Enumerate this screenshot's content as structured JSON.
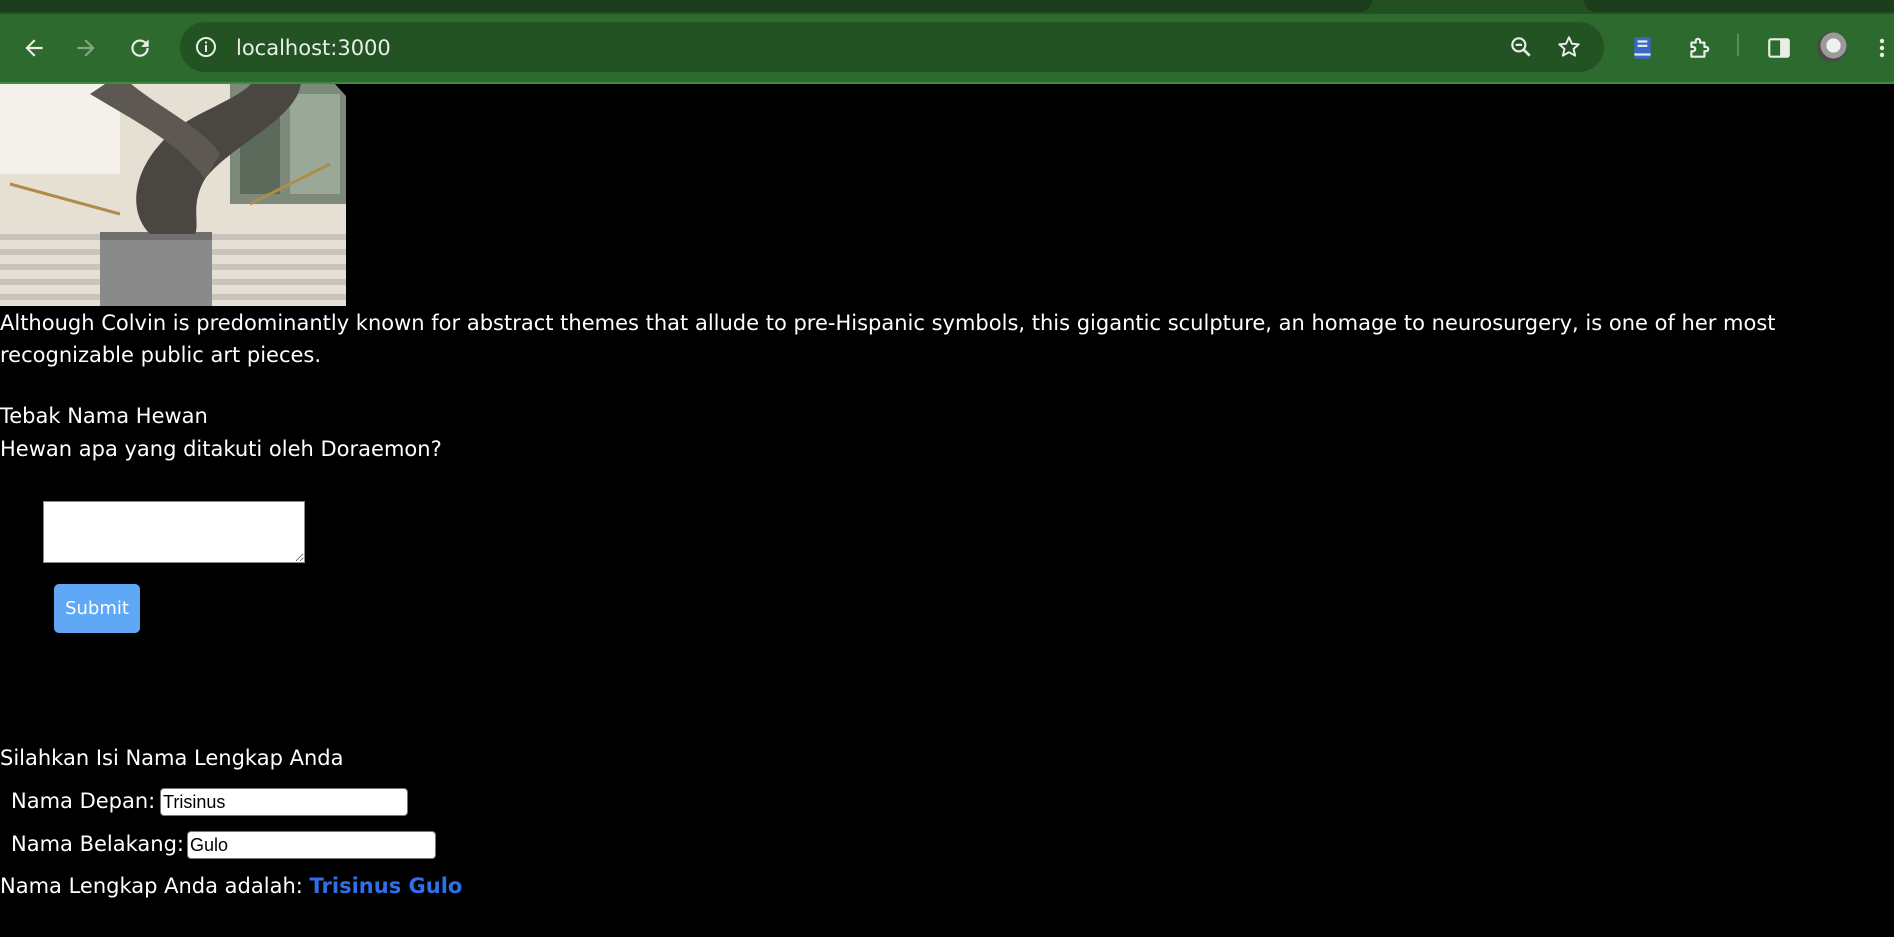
{
  "browser": {
    "url": "localhost:3000"
  },
  "article": {
    "caption": "Although Colvin is predominantly known for abstract themes that allude to pre-Hispanic symbols, this gigantic sculpture, an homage to neurosurgery, is one of her most recognizable public art pieces."
  },
  "quiz": {
    "title": "Tebak Nama Hewan",
    "question": "Hewan apa yang ditakuti oleh Doraemon?",
    "answer_value": "",
    "submit_label": "Submit"
  },
  "name_form": {
    "title": "Silahkan Isi Nama Lengkap Anda",
    "first_name_label": "Nama Depan:",
    "first_name_value": "Trisinus",
    "last_name_label": "Nama Belakang:",
    "last_name_value": "Gulo",
    "full_name_prefix": "Nama Lengkap Anda adalah:",
    "full_name_value": "Trisinus Gulo"
  },
  "colors": {
    "toolbar": "#2d6a2d",
    "submit_button": "#5fa8f6",
    "full_name_text": "#2f6fe8"
  }
}
